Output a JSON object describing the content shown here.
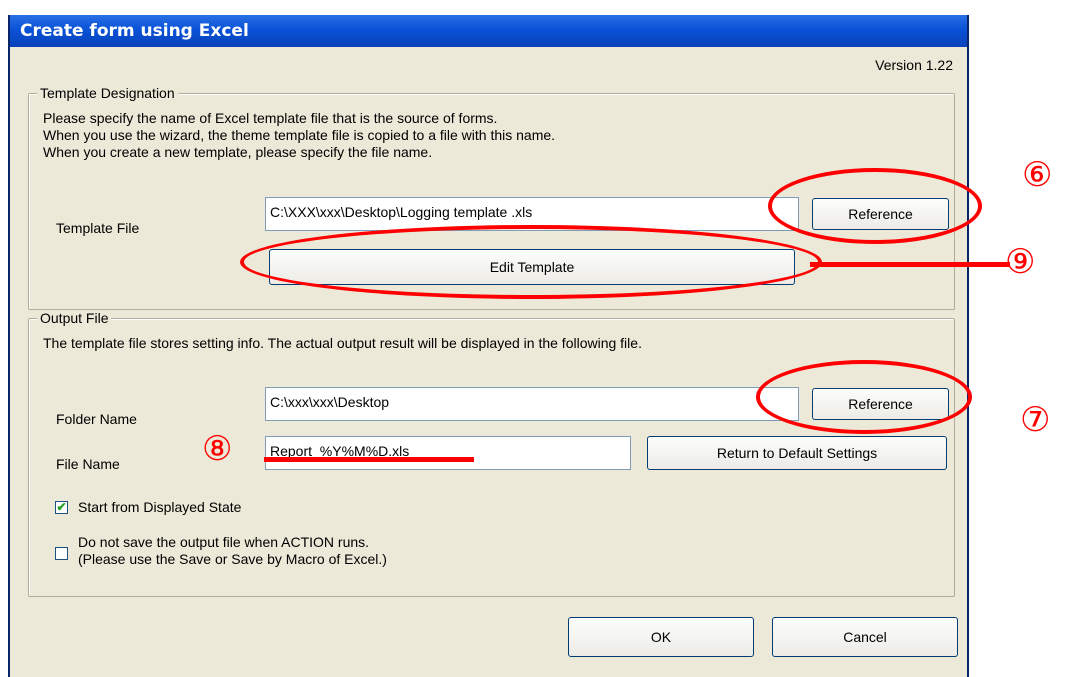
{
  "window": {
    "title": "Create form using Excel",
    "version": "Version 1.22"
  },
  "template_group": {
    "title": "Template Designation",
    "desc_lines": [
      "Please specify the name of Excel template file that is the source of forms.",
      "When you use the wizard, the theme template file is copied to a file with this name.",
      "When you create a new template, please specify the file name."
    ],
    "file_label": "Template File",
    "file_value": "C:\\XXX\\xxx\\Desktop\\Logging template .xls",
    "reference_label": "Reference",
    "edit_template_label": "Edit Template"
  },
  "output_group": {
    "title": "Output File",
    "desc": "The template file stores setting info. The actual output result will be displayed in the following file.",
    "folder_label": "Folder Name",
    "folder_value": "C:\\xxx\\xxx\\Desktop",
    "reference_label": "Reference",
    "file_label": "File Name",
    "file_value": "Report_%Y%M%D.xls",
    "default_label": "Return to Default Settings",
    "start_label": "Start from Displayed State",
    "start_checked": true,
    "nosave_line1": "Do not save the output file when ACTION runs.",
    "nosave_line2": "(Please use the Save or Save by Macro of Excel.)",
    "nosave_checked": false
  },
  "buttons": {
    "ok": "OK",
    "cancel": "Cancel"
  },
  "annotations": {
    "m6": "⑥",
    "m7": "⑦",
    "m8": "⑧",
    "m9": "⑨"
  },
  "colors": {
    "annotation": "#ff0000",
    "titlebar": "#0a52d8",
    "dialog_bg": "#ece9d8"
  }
}
